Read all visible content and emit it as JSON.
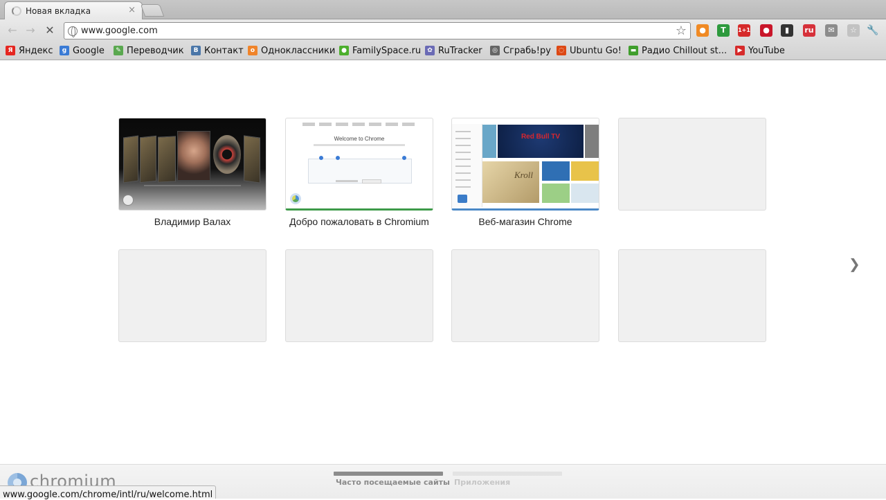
{
  "tab": {
    "title": "Новая вкладка",
    "close": "×"
  },
  "toolbar": {
    "back": "←",
    "forward": "→",
    "stop": "✕",
    "url": "www.google.com",
    "star": "☆"
  },
  "extensions": [
    {
      "name": "ext-orange",
      "label": "●",
      "color": "#f08a24"
    },
    {
      "name": "ext-t",
      "label": "T",
      "color": "#2e9a3e"
    },
    {
      "name": "ext-1plus1",
      "label": "1+1",
      "color": "#d62a2a"
    },
    {
      "name": "ext-red-circle",
      "label": "●",
      "color": "#c9162a"
    },
    {
      "name": "ext-black",
      "label": "▮",
      "color": "#333333"
    },
    {
      "name": "ext-ru",
      "label": "ru",
      "color": "#d6313a"
    },
    {
      "name": "ext-gmail",
      "label": "✉",
      "color": "#8c8c8c"
    },
    {
      "name": "ext-grey",
      "label": "☆",
      "color": "#c2c2c2"
    }
  ],
  "wrench": "🔧",
  "bookmarks": [
    {
      "label": "Яндекс",
      "icon": "yandex-icon",
      "color": "#e52620",
      "glyph": "Я"
    },
    {
      "label": "Google",
      "icon": "google-icon",
      "color": "#3a7bd5",
      "glyph": "g"
    },
    {
      "label": "Переводчик",
      "icon": "translate-icon",
      "color": "#5aa84f",
      "glyph": "✎"
    },
    {
      "label": "Контакт",
      "icon": "vk-icon",
      "color": "#4a76a8",
      "glyph": "В"
    },
    {
      "label": "Одноклассники",
      "icon": "ok-icon",
      "color": "#f0842a",
      "glyph": "о"
    },
    {
      "label": "FamilySpace.ru",
      "icon": "familyspace-icon",
      "color": "#4caf2d",
      "glyph": "●"
    },
    {
      "label": "RuTracker",
      "icon": "rutracker-icon",
      "color": "#6b6bb5",
      "glyph": "✿"
    },
    {
      "label": "Сграбь!ру",
      "icon": "sgrab-icon",
      "color": "#666666",
      "glyph": "◎"
    },
    {
      "label": "Ubuntu Go!",
      "icon": "ubuntu-icon",
      "color": "#dd4814",
      "glyph": "◌"
    },
    {
      "label": "Радио Chillout st...",
      "icon": "radio-icon",
      "color": "#3f9e2c",
      "glyph": "▬"
    },
    {
      "label": "YouTube",
      "icon": "youtube-icon",
      "color": "#d62a2a",
      "glyph": "▶"
    }
  ],
  "tiles": [
    {
      "title": "Владимир Валах"
    },
    {
      "title": "Добро пожаловать в Chromium"
    },
    {
      "title": "Веб-магазин Chrome"
    }
  ],
  "tile2": {
    "welcome": "Welcome to Chrome"
  },
  "tile3": {
    "redbull": "Red Bull TV",
    "kroll": "Kroll"
  },
  "next_chevron": "❯",
  "footer": {
    "logo_text": "chromium",
    "tabs": [
      {
        "label": "Часто посещаемые сайты",
        "active": true
      },
      {
        "label": "Приложения",
        "active": false
      }
    ]
  },
  "status": "www.google.com/chrome/intl/ru/welcome.html"
}
